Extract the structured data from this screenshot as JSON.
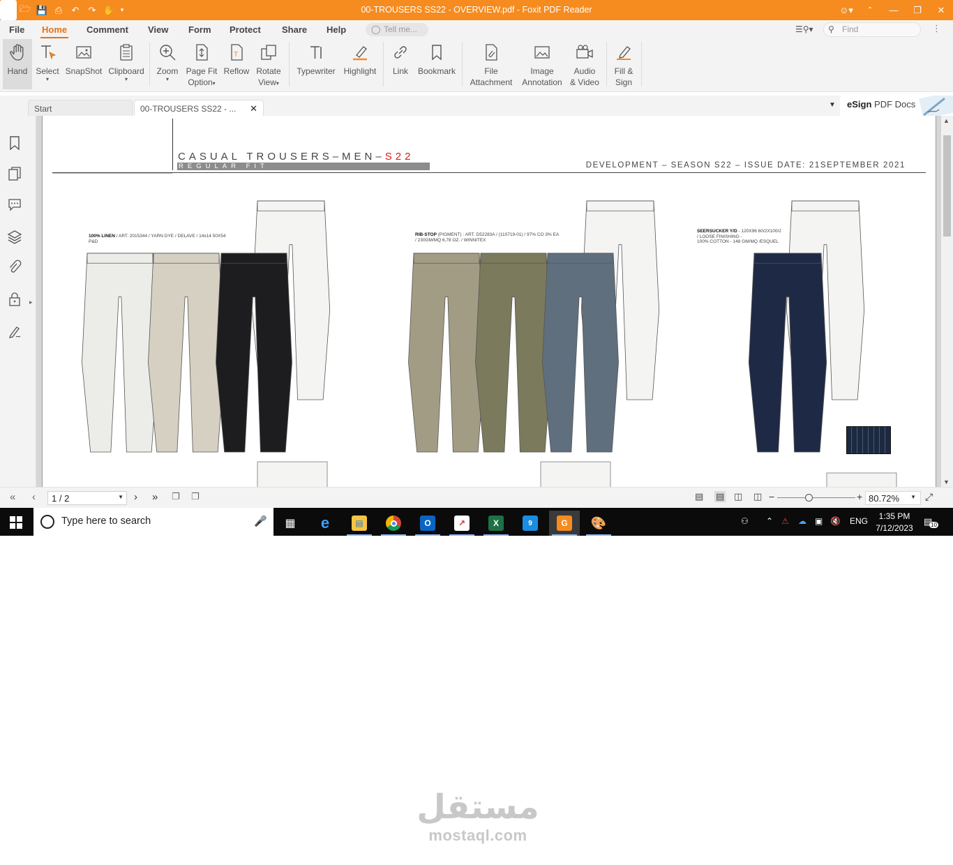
{
  "window": {
    "title": "00-TROUSERS  SS22 - OVERVIEW.pdf - Foxit PDF Reader",
    "accent": "#f68b1f"
  },
  "menu": {
    "tabs": [
      "File",
      "Home",
      "Comment",
      "View",
      "Form",
      "Protect",
      "Share",
      "Help"
    ],
    "active": "Home",
    "tell_me_placeholder": "Tell me...",
    "find_placeholder": "Find"
  },
  "ribbon": {
    "hand": "Hand",
    "select": "Select",
    "snapshot": "SnapShot",
    "clipboard": "Clipboard",
    "zoom": "Zoom",
    "page_fit_1": "Page Fit",
    "page_fit_2": "Option",
    "reflow": "Reflow",
    "rotate_1": "Rotate",
    "rotate_2": "View",
    "typewriter": "Typewriter",
    "highlight": "Highlight",
    "link": "Link",
    "bookmark": "Bookmark",
    "file_att_1": "File",
    "file_att_2": "Attachment",
    "image_ann_1": "Image",
    "image_ann_2": "Annotation",
    "audio_1": "Audio",
    "audio_2": "& Video",
    "fill_1": "Fill &",
    "fill_2": "Sign"
  },
  "doc_tabs": {
    "start": "Start",
    "current": "00-TROUSERS  SS22 - ...",
    "esign_bold": "eSign",
    "esign_rest": " PDF Docs"
  },
  "page": {
    "title_main": "CASUAL TROUSERS–MEN–",
    "title_red": "S22",
    "subtitle": "REGULAR FIT",
    "right_header": "DEVELOPMENT – SEASON S22 – ISSUE DATE: 21SEPTEMBER 2021",
    "fabric_1_bold": "100% LINEN",
    "fabric_1_rest": " / ART. 2015344 / YARN DYE / DELAVE / 14x14 50X54",
    "fabric_1_line2": "P&D",
    "fabric_2_bold": "RIB-STOP",
    "fabric_2_rest": " (PIGMENT) : ART. D52283A / (110719-01) / 97% CO 3% EA",
    "fabric_2_line2": "/ 230GM/MQ 6,78 OZ. / WINNITEX",
    "fabric_3_bold": "SEERSUCKER Y/D",
    "fabric_3_rest": " - 120X96 60/2X100/2",
    "fabric_3_line2": "/ LOOSE FINISHING -",
    "fabric_3_line3": "100% COTTON - 148 GM/MQ /ESQUEL",
    "trouser_colors": [
      "#ecece8",
      "#d6d0c2",
      "#1d1d20",
      "#a39c85",
      "#7b7a5d",
      "#5f6f7e",
      "#1e2a45"
    ]
  },
  "bottom_bar": {
    "page_indicator": "1 / 2",
    "zoom": "80.72%"
  },
  "taskbar": {
    "search_placeholder": "Type here to search",
    "lang": "ENG",
    "time": "1:35 PM",
    "date": "7/12/2023",
    "notifications": "10"
  },
  "watermark": {
    "arabic": "مستقل",
    "latin": "mostaql.com"
  }
}
